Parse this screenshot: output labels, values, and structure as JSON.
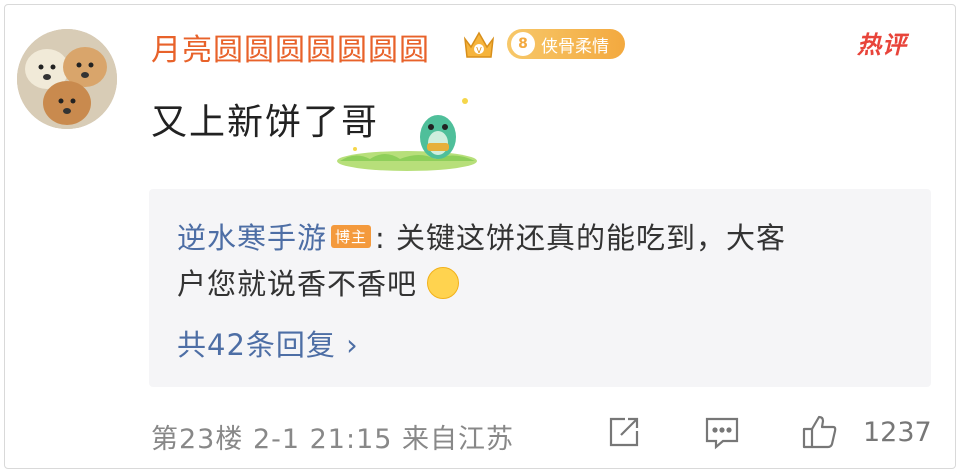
{
  "comment": {
    "username": "月亮圆圆圆圆圆圆圆",
    "fan_badge": {
      "level": "8",
      "label": "侠骨柔情"
    },
    "hot_tag": "热评",
    "text": "又上新饼了哥"
  },
  "reply": {
    "author": "逆水寒手游",
    "author_badge": "博主",
    "separator": ":",
    "line1": " 关键这饼还真的能吃到，大客",
    "line2": "户您就说香不香吧",
    "count_label": "共42条回复 ›"
  },
  "footer": {
    "meta": "第23楼  2-1 21:15  来自江苏",
    "like_count": "1237"
  },
  "icons": [
    "vip-crown-icon",
    "share-icon",
    "comment-icon",
    "like-icon"
  ],
  "colors": {
    "username": "#e8622a",
    "reply_author": "#4d6ea5",
    "hot_tag": "#e8443a",
    "badge": "#f3a93f"
  }
}
